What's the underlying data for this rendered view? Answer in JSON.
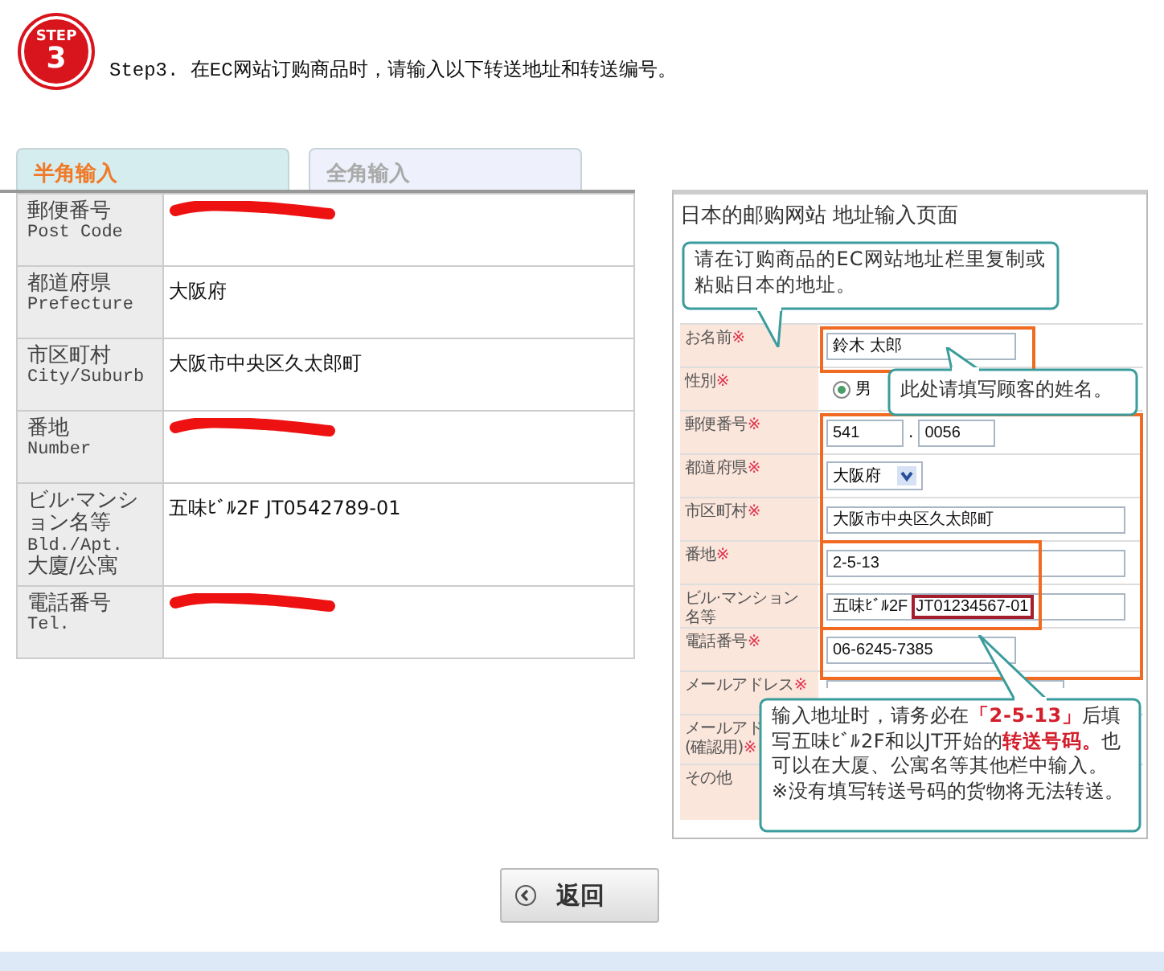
{
  "step": {
    "badge_top": "STEP",
    "badge_number": "3",
    "text": "Step3. 在EC网站订购商品时，请输入以下转送地址和转送编号。"
  },
  "tabs": [
    {
      "label": "半角输入",
      "selected": true
    },
    {
      "label": "全角输入",
      "selected": false
    }
  ],
  "address_table": {
    "rows": [
      {
        "label": "郵便番号",
        "label_en": "Post Code",
        "redacted": true
      },
      {
        "label": "都道府県",
        "label_en": "Prefecture",
        "value": "大阪府",
        "redacted": false
      },
      {
        "label": "市区町村",
        "label_en": "City/Suburb",
        "value": "大阪市中央区久太郎町",
        "redacted": false
      },
      {
        "label": "番地",
        "label_en": "Number",
        "redacted": true
      },
      {
        "label": "ビル·マンション名等",
        "label_en": "Bld./Apt.",
        "label_cn": "大廈/公寓",
        "value": "五味ﾋﾞﾙ2F JT0542789-01",
        "redacted": false
      },
      {
        "label": "電話番号",
        "label_en": "Tel.",
        "redacted": true
      }
    ]
  },
  "example": {
    "title": "日本的邮购网站 地址输入页面",
    "callouts": [
      {
        "paragraphs": [
          [
            {
              "text": "请在订购商品的EC网站地址栏里复制或粘贴日本的地址。",
              "highlight": false
            }
          ]
        ]
      },
      {
        "paragraphs": [
          [
            {
              "text": "此处请填写顾客的姓名。",
              "highlight": false
            }
          ]
        ]
      },
      {
        "paragraphs": [
          [
            {
              "text": "输入地址时，请务必在",
              "highlight": false
            },
            {
              "text": "「2-5-13」",
              "highlight": true
            },
            {
              "text": "后填写五味ﾋﾞﾙ2F和以JT开始的",
              "highlight": false
            },
            {
              "text": "转送号码。",
              "highlight": true
            },
            {
              "text": "也可以在大厦、公寓名等其他栏中输入。",
              "highlight": false
            }
          ],
          [
            {
              "text": "※没有填写转送号码的货物将无法转送。",
              "highlight": false
            }
          ]
        ]
      }
    ],
    "form": {
      "rows": [
        {
          "kind": "text",
          "label": "お名前",
          "required_mark": "※",
          "value": "鈴木  太郎"
        },
        {
          "kind": "radio",
          "label": "性別",
          "required_mark": "※",
          "option": "男",
          "selected": true
        },
        {
          "kind": "postal",
          "label": "郵便番号",
          "required_mark": "※",
          "values": [
            "541",
            "0056"
          ],
          "separator": "."
        },
        {
          "kind": "select",
          "label": "都道府県",
          "required_mark": "※",
          "value": "大阪府"
        },
        {
          "kind": "text",
          "label": "市区町村",
          "required_mark": "※",
          "value": "大阪市中央区久太郎町"
        },
        {
          "kind": "text",
          "label": "番地",
          "required_mark": "※",
          "value": "2-5-13"
        },
        {
          "kind": "text",
          "label": "ビル·マンション名等",
          "value": "五味ﾋﾞﾙ2F",
          "code": "JT01234567-01"
        },
        {
          "kind": "text",
          "label": "電話番号",
          "required_mark": "※",
          "value": "06-6245-7385"
        },
        {
          "kind": "partial",
          "label": "メールアドレス",
          "required_mark": "※"
        },
        {
          "kind": "empty",
          "label": "メールアド",
          "label_2": "(確認用)",
          "required_mark": "※"
        },
        {
          "kind": "empty",
          "label": "その他"
        }
      ]
    }
  },
  "back_button": {
    "label": "返回"
  }
}
